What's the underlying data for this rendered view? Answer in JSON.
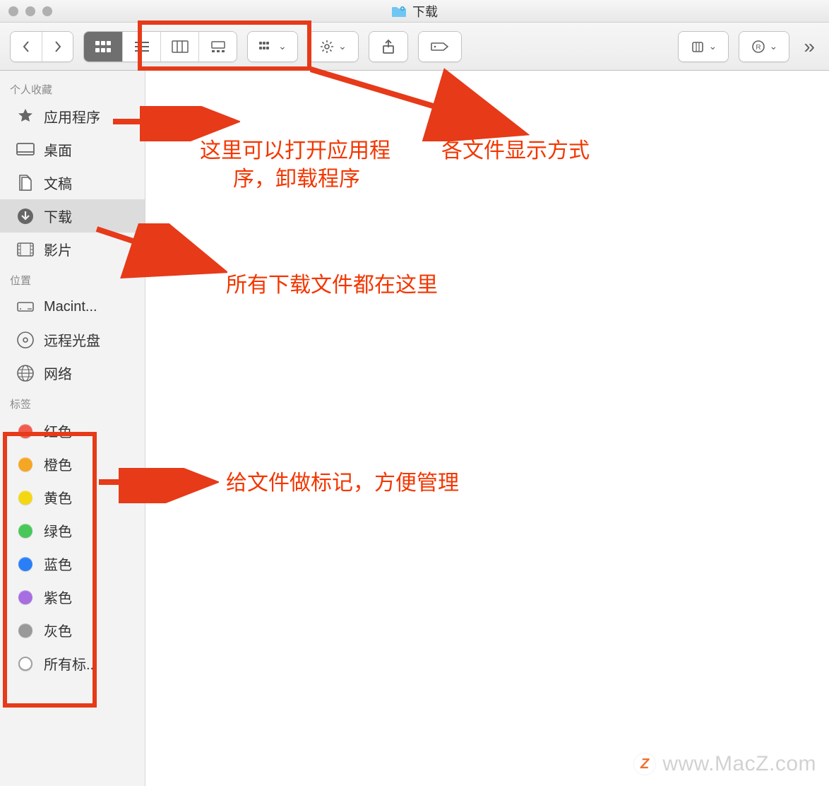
{
  "window": {
    "title": "下载"
  },
  "sidebar": {
    "sections": [
      {
        "header": "个人收藏",
        "items": [
          {
            "label": "应用程序",
            "icon": "apps-icon"
          },
          {
            "label": "桌面",
            "icon": "desktop-icon"
          },
          {
            "label": "文稿",
            "icon": "documents-icon"
          },
          {
            "label": "下载",
            "icon": "downloads-icon",
            "selected": true
          },
          {
            "label": "影片",
            "icon": "movies-icon"
          }
        ]
      },
      {
        "header": "位置",
        "items": [
          {
            "label": "Macint...",
            "icon": "hdd-icon"
          },
          {
            "label": "远程光盘",
            "icon": "disc-icon"
          },
          {
            "label": "网络",
            "icon": "network-icon"
          }
        ]
      }
    ],
    "tags": {
      "header": "标签",
      "items": [
        {
          "label": "红色",
          "color": "#f05c4f"
        },
        {
          "label": "橙色",
          "color": "#f5a623"
        },
        {
          "label": "黄色",
          "color": "#f4d714"
        },
        {
          "label": "绿色",
          "color": "#4ac759"
        },
        {
          "label": "蓝色",
          "color": "#2a7ff6"
        },
        {
          "label": "紫色",
          "color": "#a66ee0"
        },
        {
          "label": "灰色",
          "color": "#999999"
        }
      ],
      "all_label": "所有标..."
    }
  },
  "toolbar": {
    "views": [
      "icon",
      "list",
      "column",
      "gallery"
    ],
    "active_view": "icon"
  },
  "annotations": {
    "apps_line1": "这里可以打开应用程",
    "apps_line2": "序，卸载程序",
    "views": "各文件显示方式",
    "downloads": "所有下载文件都在这里",
    "tags": "给文件做标记，方便管理"
  },
  "watermark": "www.MacZ.com"
}
